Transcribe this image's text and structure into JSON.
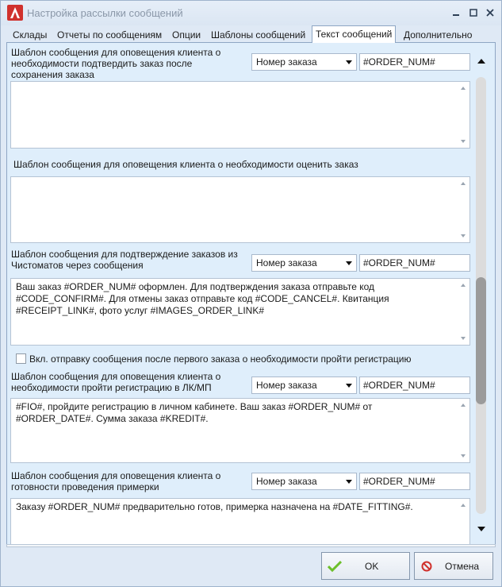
{
  "window": {
    "title": "Настройка рассылки сообщений"
  },
  "tabs": [
    {
      "label": "Склады"
    },
    {
      "label": "Отчеты по сообщениям"
    },
    {
      "label": "Опции"
    },
    {
      "label": "Шаблоны сообщений"
    },
    {
      "label": "Текст сообщений",
      "active": true
    },
    {
      "label": "Дополнительно"
    }
  ],
  "sections": {
    "confirm_order": {
      "label": "Шаблон сообщения для оповещения клиента о необходимости подтвердить заказ после сохранения заказа",
      "combo_value": "Номер заказа",
      "tag": "#ORDER_NUM#",
      "text": ""
    },
    "rate_order": {
      "label": "Шаблон сообщения для оповещения клиента о необходимости оценить заказ",
      "text": ""
    },
    "chistomat_confirm": {
      "label": "Шаблон сообщения для подтверждение заказов из Чистоматов через сообщения",
      "combo_value": "Номер заказа",
      "tag": "#ORDER_NUM#",
      "text": "Ваш заказ #ORDER_NUM# оформлен. Для подтверждения заказа отправьте код #CODE_CONFIRM#. Для отмены заказ отправьте код #CODE_CANCEL#. Квитанция #RECEIPT_LINK#, фото услуг #IMAGES_ORDER_LINK#"
    },
    "registration_checkbox": {
      "label": "Вкл. отправку сообщения после первого заказа о необходимости пройти регистрацию",
      "checked": false
    },
    "registration": {
      "label": "Шаблон сообщения для оповещения клиента о необходимости пройти регистрацию в ЛК/МП",
      "combo_value": "Номер заказа",
      "tag": "#ORDER_NUM#",
      "text": "#FIO#, пройдите регистрацию в личном кабинете. Ваш заказ #ORDER_NUM# от #ORDER_DATE#. Сумма заказа #KREDIT#."
    },
    "fitting": {
      "label": "Шаблон сообщения для оповещения клиента о готовности проведения примерки",
      "combo_value": "Номер заказа",
      "tag": "#ORDER_NUM#",
      "text": "Заказу #ORDER_NUM# предварительно готов, примерка назначена на #DATE_FITTING#."
    }
  },
  "buttons": {
    "ok": "OK",
    "cancel": "Отмена"
  },
  "colors": {
    "accent_red": "#d0312d",
    "ok_green": "#6cbf2a",
    "panel_bg": "#dfeefb"
  }
}
